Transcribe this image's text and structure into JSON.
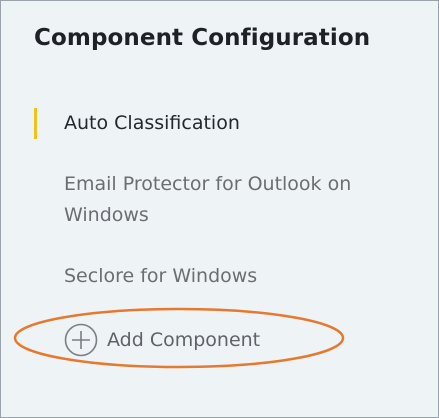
{
  "panel": {
    "title": "Component Configuration"
  },
  "nav": {
    "items": [
      {
        "label": "Auto Classification",
        "active": true
      },
      {
        "label": "Email Protector for Outlook on Windows",
        "line1": "Email Protector for Outlook on",
        "line2": "Windows",
        "active": false
      },
      {
        "label": "Seclore for Windows",
        "active": false
      }
    ],
    "add_label": "Add Component"
  },
  "colors": {
    "panel_background": "#eef3f6",
    "active_indicator": "#f2c218",
    "highlight_oval": "#e8782e",
    "title_text": "#1e2226",
    "inactive_text": "#6b6e71"
  },
  "icons": {
    "add": "plus-circle-icon"
  }
}
